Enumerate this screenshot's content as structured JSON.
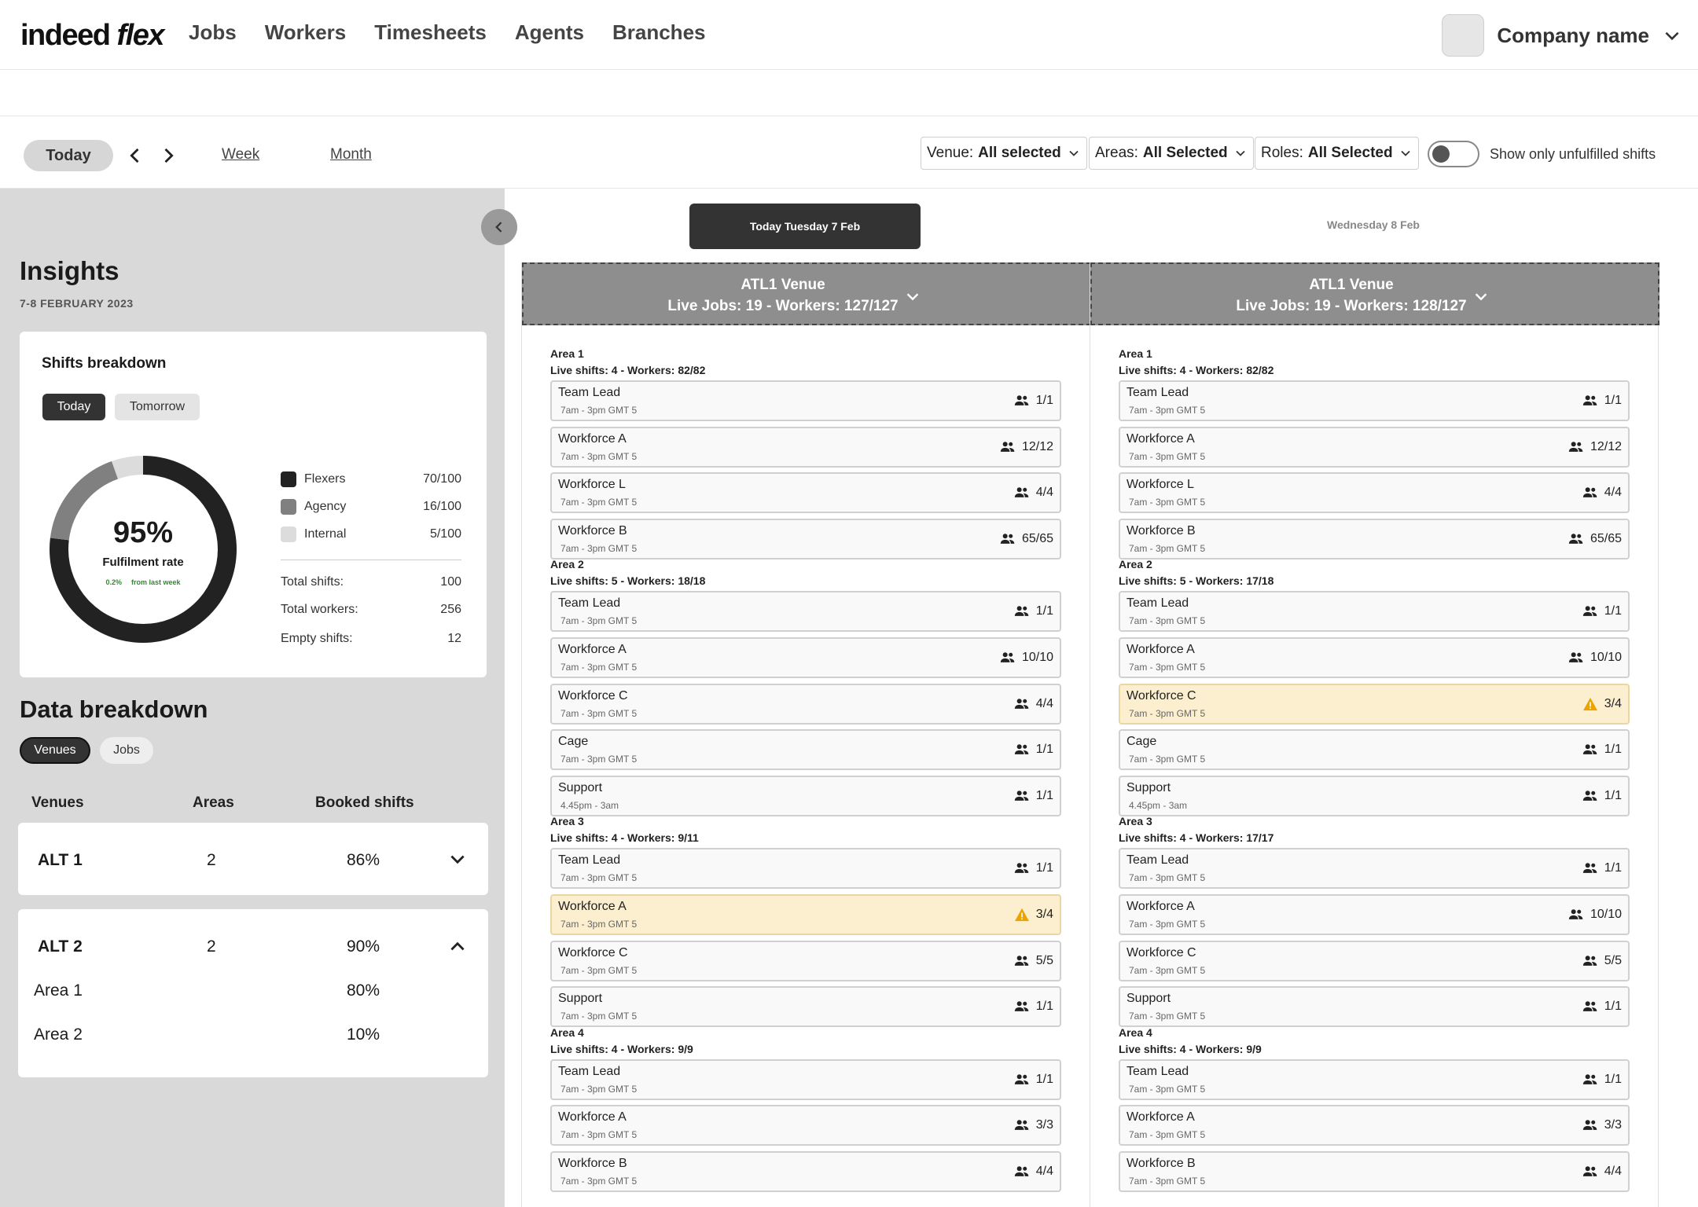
{
  "nav": {
    "logo_part1": "indeed",
    "logo_part2": "flex",
    "links": [
      "Jobs",
      "Workers",
      "Timesheets",
      "Agents",
      "Branches"
    ],
    "company": "Company name"
  },
  "toolbar": {
    "today": "Today",
    "week": "Week",
    "month": "Month",
    "venue_label": "Venue:",
    "venue_value": "All selected",
    "areas_label": "Areas:",
    "areas_value": "All Selected",
    "roles_label": "Roles:",
    "roles_value": "All Selected",
    "toggle_label": "Show only unfulfilled shifts",
    "toggle_on": false
  },
  "insights": {
    "title": "Insights",
    "date": "7-8 FEBRUARY 2023",
    "shifts_title": "Shifts breakdown",
    "tab_today": "Today",
    "tab_tomorrow": "Tomorrow",
    "fulfilment_pct": "95%",
    "fulfilment_label": "Fulfilment rate",
    "change_value": "0.2%",
    "change_label": "from last week",
    "legend": [
      {
        "label": "Flexers",
        "value": "70/100",
        "color": "#222222"
      },
      {
        "label": "Agency",
        "value": "16/100",
        "color": "#808080"
      },
      {
        "label": "Internal",
        "value": "5/100",
        "color": "#dcdcdc"
      }
    ],
    "stats": [
      {
        "label": "Total shifts:",
        "value": "100"
      },
      {
        "label": "Total workers:",
        "value": "256"
      },
      {
        "label": "Empty shifts:",
        "value": "12"
      }
    ],
    "donut_fractions": {
      "flexers": 0.7,
      "agency": 0.16,
      "internal": 0.05
    }
  },
  "data_breakdown": {
    "title": "Data breakdown",
    "tab_venues": "Venues",
    "tab_jobs": "Jobs",
    "col_venues": "Venues",
    "col_areas": "Areas",
    "col_booked": "Booked shifts",
    "venues": [
      {
        "name": "ALT 1",
        "areas": "2",
        "booked": "86%",
        "expanded": false
      },
      {
        "name": "ALT 2",
        "areas": "2",
        "booked": "90%",
        "expanded": true,
        "sub": [
          {
            "name": "Area 1",
            "value": "80%"
          },
          {
            "name": "Area 2",
            "value": "10%"
          }
        ]
      }
    ]
  },
  "schedule": {
    "day_active": "Today Tuesday 7 Feb",
    "day_next": "Wednesday 8 Feb",
    "columns": [
      {
        "venue": "ATL1 Venue",
        "summary": "Live Jobs: 19 - Workers: 127/127",
        "areas": [
          {
            "name": "Area 1",
            "summary": "Live shifts: 4 - Workers: 82/82",
            "shifts": [
              {
                "role": "Team Lead",
                "time": "7am - 3pm GMT 5",
                "count": "1/1",
                "warn": false
              },
              {
                "role": "Workforce A",
                "time": "7am - 3pm GMT 5",
                "count": "12/12",
                "warn": false
              },
              {
                "role": "Workforce L",
                "time": "7am - 3pm GMT 5",
                "count": "4/4",
                "warn": false
              },
              {
                "role": "Workforce B",
                "time": "7am - 3pm GMT 5",
                "count": "65/65",
                "warn": false
              }
            ]
          },
          {
            "name": "Area 2",
            "summary": "Live shifts: 5 - Workers: 18/18",
            "shifts": [
              {
                "role": "Team Lead",
                "time": "7am - 3pm GMT 5",
                "count": "1/1",
                "warn": false
              },
              {
                "role": "Workforce A",
                "time": "7am - 3pm GMT 5",
                "count": "10/10",
                "warn": false
              },
              {
                "role": "Workforce C",
                "time": "7am - 3pm GMT 5",
                "count": "4/4",
                "warn": false
              },
              {
                "role": "Cage",
                "time": "7am - 3pm GMT 5",
                "count": "1/1",
                "warn": false
              },
              {
                "role": "Support",
                "time": "4.45pm - 3am",
                "count": "1/1",
                "warn": false
              }
            ]
          },
          {
            "name": "Area 3",
            "summary": "Live shifts: 4 - Workers: 9/11",
            "shifts": [
              {
                "role": "Team Lead",
                "time": "7am - 3pm GMT 5",
                "count": "1/1",
                "warn": false
              },
              {
                "role": "Workforce A",
                "time": "7am - 3pm GMT 5",
                "count": "3/4",
                "warn": true
              },
              {
                "role": "Workforce C",
                "time": "7am - 3pm GMT 5",
                "count": "5/5",
                "warn": false
              },
              {
                "role": "Support",
                "time": "7am - 3pm GMT 5",
                "count": "1/1",
                "warn": false
              }
            ]
          },
          {
            "name": "Area 4",
            "summary": "Live shifts: 4 - Workers: 9/9",
            "shifts": [
              {
                "role": "Team Lead",
                "time": "7am - 3pm GMT 5",
                "count": "1/1",
                "warn": false
              },
              {
                "role": "Workforce A",
                "time": "7am - 3pm GMT 5",
                "count": "3/3",
                "warn": false
              },
              {
                "role": "Workforce B",
                "time": "7am - 3pm GMT 5",
                "count": "4/4",
                "warn": false
              }
            ]
          }
        ]
      },
      {
        "venue": "ATL1 Venue",
        "summary": "Live Jobs: 19 - Workers: 128/127",
        "areas": [
          {
            "name": "Area 1",
            "summary": "Live shifts: 4 - Workers: 82/82",
            "shifts": [
              {
                "role": "Team Lead",
                "time": "7am - 3pm GMT 5",
                "count": "1/1",
                "warn": false
              },
              {
                "role": "Workforce A",
                "time": "7am - 3pm GMT 5",
                "count": "12/12",
                "warn": false
              },
              {
                "role": "Workforce L",
                "time": "7am - 3pm GMT 5",
                "count": "4/4",
                "warn": false
              },
              {
                "role": "Workforce B",
                "time": "7am - 3pm GMT 5",
                "count": "65/65",
                "warn": false
              }
            ]
          },
          {
            "name": "Area 2",
            "summary": "Live shifts: 5 - Workers: 17/18",
            "shifts": [
              {
                "role": "Team Lead",
                "time": "7am - 3pm GMT 5",
                "count": "1/1",
                "warn": false
              },
              {
                "role": "Workforce A",
                "time": "7am - 3pm GMT 5",
                "count": "10/10",
                "warn": false
              },
              {
                "role": "Workforce C",
                "time": "7am - 3pm GMT 5",
                "count": "3/4",
                "warn": true
              },
              {
                "role": "Cage",
                "time": "7am - 3pm GMT 5",
                "count": "1/1",
                "warn": false
              },
              {
                "role": "Support",
                "time": "4.45pm - 3am",
                "count": "1/1",
                "warn": false
              }
            ]
          },
          {
            "name": "Area 3",
            "summary": "Live shifts: 4 - Workers: 17/17",
            "shifts": [
              {
                "role": "Team Lead",
                "time": "7am - 3pm GMT 5",
                "count": "1/1",
                "warn": false
              },
              {
                "role": "Workforce A",
                "time": "7am - 3pm GMT 5",
                "count": "10/10",
                "warn": false
              },
              {
                "role": "Workforce C",
                "time": "7am - 3pm GMT 5",
                "count": "5/5",
                "warn": false
              },
              {
                "role": "Support",
                "time": "7am - 3pm GMT 5",
                "count": "1/1",
                "warn": false
              }
            ]
          },
          {
            "name": "Area 4",
            "summary": "Live shifts: 4 - Workers: 9/9",
            "shifts": [
              {
                "role": "Team Lead",
                "time": "7am - 3pm GMT 5",
                "count": "1/1",
                "warn": false
              },
              {
                "role": "Workforce A",
                "time": "7am - 3pm GMT 5",
                "count": "3/3",
                "warn": false
              },
              {
                "role": "Workforce B",
                "time": "7am - 3pm GMT 5",
                "count": "4/4",
                "warn": false
              }
            ]
          }
        ]
      }
    ]
  }
}
